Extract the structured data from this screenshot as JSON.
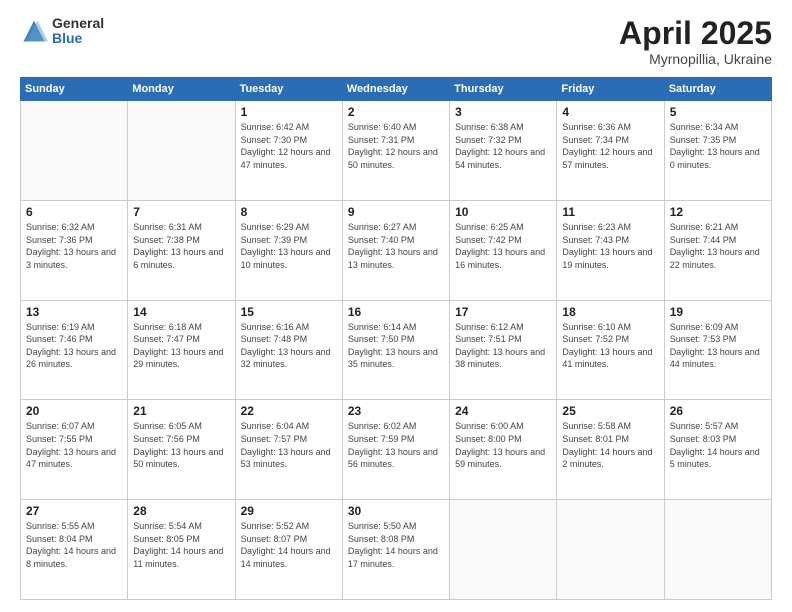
{
  "logo": {
    "general": "General",
    "blue": "Blue"
  },
  "header": {
    "month": "April 2025",
    "location": "Myrnopillia, Ukraine"
  },
  "weekdays": [
    "Sunday",
    "Monday",
    "Tuesday",
    "Wednesday",
    "Thursday",
    "Friday",
    "Saturday"
  ],
  "weeks": [
    [
      {
        "day": "",
        "empty": true
      },
      {
        "day": "",
        "empty": true
      },
      {
        "day": "1",
        "sunrise": "6:42 AM",
        "sunset": "7:30 PM",
        "daylight": "12 hours and 47 minutes."
      },
      {
        "day": "2",
        "sunrise": "6:40 AM",
        "sunset": "7:31 PM",
        "daylight": "12 hours and 50 minutes."
      },
      {
        "day": "3",
        "sunrise": "6:38 AM",
        "sunset": "7:32 PM",
        "daylight": "12 hours and 54 minutes."
      },
      {
        "day": "4",
        "sunrise": "6:36 AM",
        "sunset": "7:34 PM",
        "daylight": "12 hours and 57 minutes."
      },
      {
        "day": "5",
        "sunrise": "6:34 AM",
        "sunset": "7:35 PM",
        "daylight": "13 hours and 0 minutes."
      }
    ],
    [
      {
        "day": "6",
        "sunrise": "6:32 AM",
        "sunset": "7:36 PM",
        "daylight": "13 hours and 3 minutes."
      },
      {
        "day": "7",
        "sunrise": "6:31 AM",
        "sunset": "7:38 PM",
        "daylight": "13 hours and 6 minutes."
      },
      {
        "day": "8",
        "sunrise": "6:29 AM",
        "sunset": "7:39 PM",
        "daylight": "13 hours and 10 minutes."
      },
      {
        "day": "9",
        "sunrise": "6:27 AM",
        "sunset": "7:40 PM",
        "daylight": "13 hours and 13 minutes."
      },
      {
        "day": "10",
        "sunrise": "6:25 AM",
        "sunset": "7:42 PM",
        "daylight": "13 hours and 16 minutes."
      },
      {
        "day": "11",
        "sunrise": "6:23 AM",
        "sunset": "7:43 PM",
        "daylight": "13 hours and 19 minutes."
      },
      {
        "day": "12",
        "sunrise": "6:21 AM",
        "sunset": "7:44 PM",
        "daylight": "13 hours and 22 minutes."
      }
    ],
    [
      {
        "day": "13",
        "sunrise": "6:19 AM",
        "sunset": "7:46 PM",
        "daylight": "13 hours and 26 minutes."
      },
      {
        "day": "14",
        "sunrise": "6:18 AM",
        "sunset": "7:47 PM",
        "daylight": "13 hours and 29 minutes."
      },
      {
        "day": "15",
        "sunrise": "6:16 AM",
        "sunset": "7:48 PM",
        "daylight": "13 hours and 32 minutes."
      },
      {
        "day": "16",
        "sunrise": "6:14 AM",
        "sunset": "7:50 PM",
        "daylight": "13 hours and 35 minutes."
      },
      {
        "day": "17",
        "sunrise": "6:12 AM",
        "sunset": "7:51 PM",
        "daylight": "13 hours and 38 minutes."
      },
      {
        "day": "18",
        "sunrise": "6:10 AM",
        "sunset": "7:52 PM",
        "daylight": "13 hours and 41 minutes."
      },
      {
        "day": "19",
        "sunrise": "6:09 AM",
        "sunset": "7:53 PM",
        "daylight": "13 hours and 44 minutes."
      }
    ],
    [
      {
        "day": "20",
        "sunrise": "6:07 AM",
        "sunset": "7:55 PM",
        "daylight": "13 hours and 47 minutes."
      },
      {
        "day": "21",
        "sunrise": "6:05 AM",
        "sunset": "7:56 PM",
        "daylight": "13 hours and 50 minutes."
      },
      {
        "day": "22",
        "sunrise": "6:04 AM",
        "sunset": "7:57 PM",
        "daylight": "13 hours and 53 minutes."
      },
      {
        "day": "23",
        "sunrise": "6:02 AM",
        "sunset": "7:59 PM",
        "daylight": "13 hours and 56 minutes."
      },
      {
        "day": "24",
        "sunrise": "6:00 AM",
        "sunset": "8:00 PM",
        "daylight": "13 hours and 59 minutes."
      },
      {
        "day": "25",
        "sunrise": "5:58 AM",
        "sunset": "8:01 PM",
        "daylight": "14 hours and 2 minutes."
      },
      {
        "day": "26",
        "sunrise": "5:57 AM",
        "sunset": "8:03 PM",
        "daylight": "14 hours and 5 minutes."
      }
    ],
    [
      {
        "day": "27",
        "sunrise": "5:55 AM",
        "sunset": "8:04 PM",
        "daylight": "14 hours and 8 minutes."
      },
      {
        "day": "28",
        "sunrise": "5:54 AM",
        "sunset": "8:05 PM",
        "daylight": "14 hours and 11 minutes."
      },
      {
        "day": "29",
        "sunrise": "5:52 AM",
        "sunset": "8:07 PM",
        "daylight": "14 hours and 14 minutes."
      },
      {
        "day": "30",
        "sunrise": "5:50 AM",
        "sunset": "8:08 PM",
        "daylight": "14 hours and 17 minutes."
      },
      {
        "day": "",
        "empty": true
      },
      {
        "day": "",
        "empty": true
      },
      {
        "day": "",
        "empty": true
      }
    ]
  ]
}
